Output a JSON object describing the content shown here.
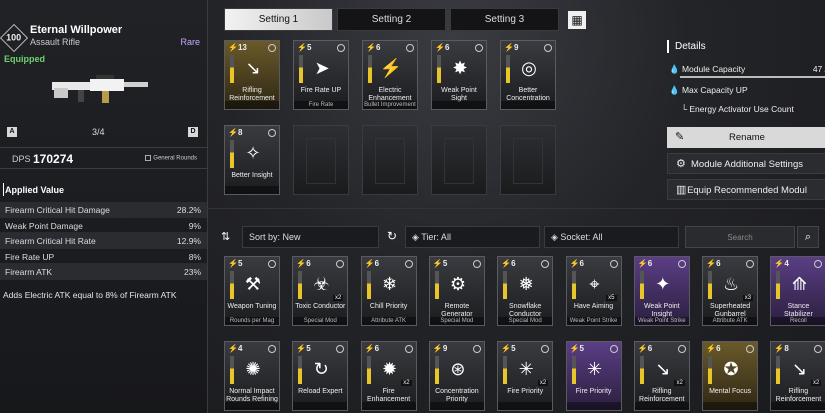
{
  "weapon": {
    "level": "100",
    "name": "Eternal Willpower",
    "type": "Assault Rifle",
    "rarity": "Rare",
    "status": "Equipped",
    "slot_left_key": "A",
    "slot_right_key": "D",
    "slot_count": "3/4",
    "dps_label": "DPS",
    "dps_value": "170274",
    "ammo_type": "General Rounds"
  },
  "applied": {
    "title": "Applied Value",
    "stats": [
      {
        "label": "Firearm Critical Hit Damage",
        "value": "28.2%"
      },
      {
        "label": "Weak Point Damage",
        "value": "9%"
      },
      {
        "label": "Firearm Critical Hit Rate",
        "value": "12.9%"
      },
      {
        "label": "Fire Rate UP",
        "value": "8%"
      },
      {
        "label": "Firearm ATK",
        "value": "23%"
      }
    ],
    "description": "Adds Electric ATK equal to 8% of Firearm ATK"
  },
  "tabs": [
    "Setting 1",
    "Setting 2",
    "Setting 3"
  ],
  "equipped_modules": [
    {
      "cap": "13",
      "name": "Rifling Reinforcement",
      "tag": "",
      "icon": "↘",
      "tier": "gold"
    },
    {
      "cap": "5",
      "name": "Fire Rate UP",
      "tag": "Fire Rate",
      "icon": "➤",
      "tier": ""
    },
    {
      "cap": "6",
      "name": "Electric Enhancement",
      "tag": "Bullet Improvement",
      "icon": "⚡",
      "tier": ""
    },
    {
      "cap": "6",
      "name": "Weak Point Sight",
      "tag": "",
      "icon": "✸",
      "tier": ""
    },
    {
      "cap": "9",
      "name": "Better Concentration",
      "tag": "",
      "icon": "◎",
      "tier": ""
    },
    {
      "cap": "8",
      "name": "Better Insight",
      "tag": "",
      "icon": "✧",
      "tier": ""
    }
  ],
  "details": {
    "title": "Details",
    "module_capacity_label": "Module Capacity",
    "module_capacity_value": "47 /",
    "max_capacity_label": "Max Capacity UP",
    "energy_label": "Energy Activator Use Count"
  },
  "buttons": {
    "rename": "Rename",
    "additional": "Module Additional Settings",
    "equip": "Equip Recommended Modul"
  },
  "filters": {
    "sort": "Sort by: New",
    "tier": "Tier: All",
    "socket": "Socket: All",
    "search_placeholder": "Search"
  },
  "inventory_row1": [
    {
      "cap": "5",
      "name": "Weapon Tuning",
      "tag": "Rounds per Mag",
      "icon": "⚒",
      "tier": "",
      "count": ""
    },
    {
      "cap": "6",
      "name": "Toxic Conductor",
      "tag": "Special Mod",
      "icon": "☣",
      "tier": "",
      "count": "x2"
    },
    {
      "cap": "6",
      "name": "Chill Priority",
      "tag": "Attribute ATK",
      "icon": "❄",
      "tier": "",
      "count": ""
    },
    {
      "cap": "5",
      "name": "Remote Generator",
      "tag": "Special Mod",
      "icon": "⚙",
      "tier": "",
      "count": ""
    },
    {
      "cap": "6",
      "name": "Snowflake Conductor",
      "tag": "Special Mod",
      "icon": "❅",
      "tier": "",
      "count": ""
    },
    {
      "cap": "6",
      "name": "Have Aiming",
      "tag": "Weak Point Strike",
      "icon": "⌖",
      "tier": "",
      "count": "x5"
    },
    {
      "cap": "6",
      "name": "Weak Point Insight",
      "tag": "Weak Point Strike",
      "icon": "✦",
      "tier": "purple",
      "count": ""
    },
    {
      "cap": "6",
      "name": "Superheated Gunbarrel",
      "tag": "Attribute ATK",
      "icon": "♨",
      "tier": "",
      "count": "x3"
    },
    {
      "cap": "4",
      "name": "Stance Stabilizer",
      "tag": "Recoil",
      "icon": "⟰",
      "tier": "purple",
      "count": ""
    }
  ],
  "inventory_row2": [
    {
      "cap": "4",
      "name": "Normal Impact Rounds Refining",
      "tag": "",
      "icon": "✺",
      "tier": "",
      "count": ""
    },
    {
      "cap": "5",
      "name": "Reload Expert",
      "tag": "",
      "icon": "↻",
      "tier": "",
      "count": ""
    },
    {
      "cap": "6",
      "name": "Fire Enhancement",
      "tag": "",
      "icon": "✹",
      "tier": "",
      "count": "x2"
    },
    {
      "cap": "9",
      "name": "Concentration Priority",
      "tag": "",
      "icon": "⊛",
      "tier": "",
      "count": ""
    },
    {
      "cap": "5",
      "name": "Fire Priority",
      "tag": "",
      "icon": "✳",
      "tier": "",
      "count": "x2"
    },
    {
      "cap": "5",
      "name": "Fire Priority",
      "tag": "",
      "icon": "✳",
      "tier": "purple",
      "count": ""
    },
    {
      "cap": "6",
      "name": "Rifling Reinforcement",
      "tag": "",
      "icon": "↘",
      "tier": "",
      "count": "x2"
    },
    {
      "cap": "6",
      "name": "Mental Focus",
      "tag": "",
      "icon": "✪",
      "tier": "gold",
      "count": ""
    },
    {
      "cap": "8",
      "name": "Rifling Reinforcement",
      "tag": "",
      "icon": "↘",
      "tier": "",
      "count": "x2"
    }
  ]
}
